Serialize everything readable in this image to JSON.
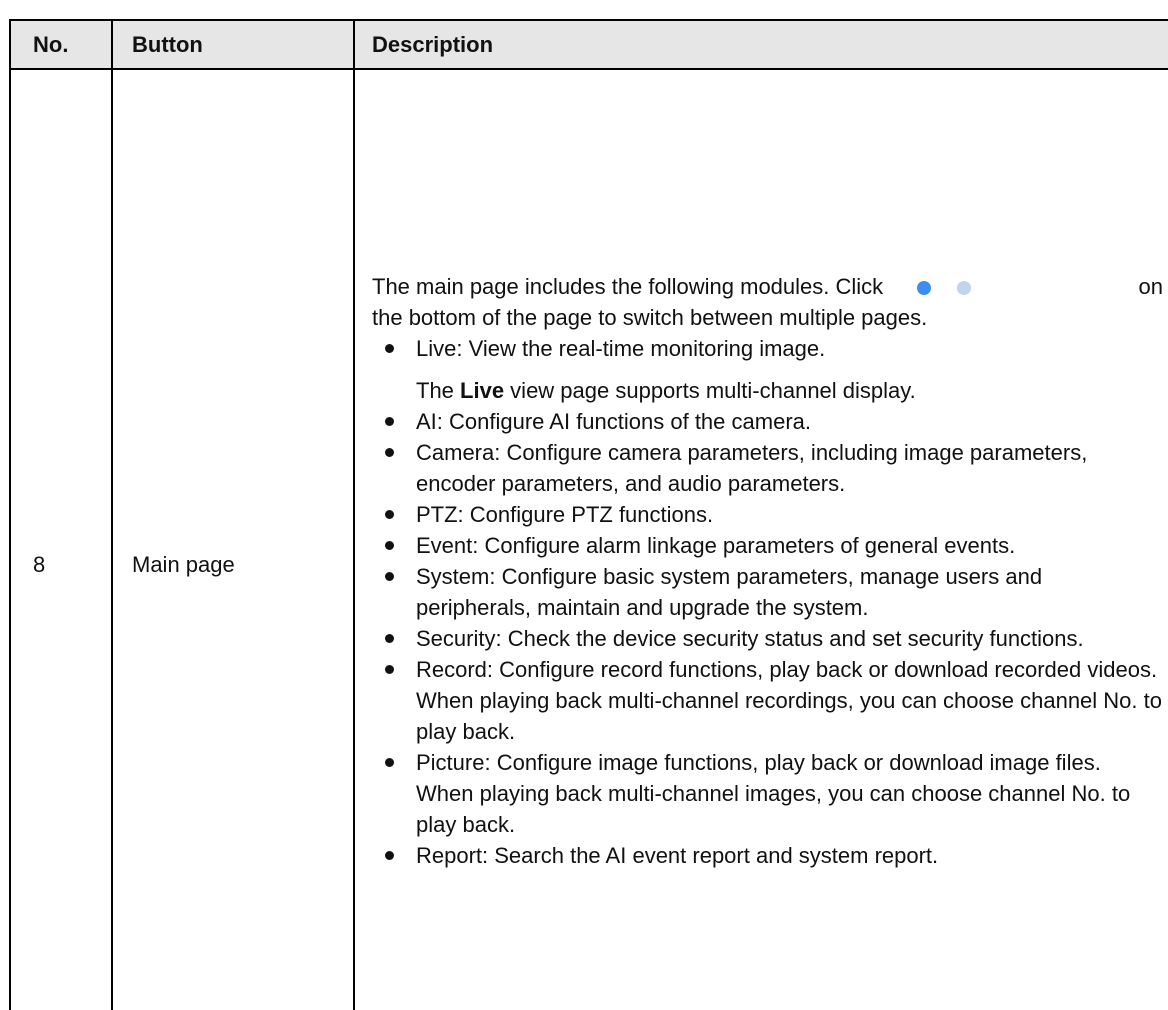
{
  "table": {
    "headers": {
      "no": "No.",
      "button": "Button",
      "description": "Description"
    },
    "row": {
      "no": "8",
      "button": "Main page",
      "intro_before": "The main page includes the following modules. Click",
      "intro_on": "on",
      "intro_after": "the bottom of the page to switch between multiple pages.",
      "pager_dots": [
        "active-dot-icon",
        "inactive-dot-icon"
      ],
      "pager_colors": {
        "active": "#3b8ef0",
        "inactive": "#c2d4ec"
      },
      "modules": [
        {
          "text": "Live: View the real-time monitoring image.",
          "note_before": "The ",
          "note_bold": "Live",
          "note_after": " view page supports multi-channel display."
        },
        {
          "text": "AI: Configure AI functions of the camera."
        },
        {
          "text": "Camera: Configure camera parameters, including image parameters, encoder parameters, and audio parameters."
        },
        {
          "text": "PTZ: Configure PTZ functions."
        },
        {
          "text": "Event: Configure alarm linkage parameters of general events."
        },
        {
          "text": "System: Configure basic system parameters, manage users and peripherals, maintain and upgrade the system."
        },
        {
          "text": "Security: Check the device security status and set security functions."
        },
        {
          "text": "Record: Configure record functions, play back or download recorded videos.",
          "note": "When playing back multi-channel recordings, you can choose channel No. to play back."
        },
        {
          "text": "Picture: Configure image functions, play back or download image files.",
          "note": "When playing back multi-channel images, you can choose channel No. to play back."
        },
        {
          "text": "Report: Search the AI event report and system report."
        }
      ]
    }
  }
}
